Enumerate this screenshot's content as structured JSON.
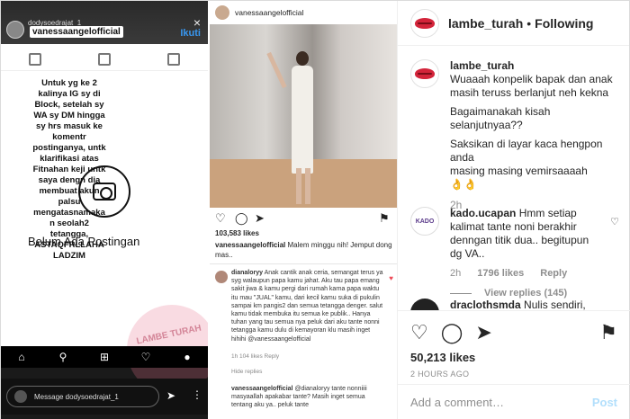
{
  "collage": {
    "story": {
      "story_user": "dodysoedrajat_1",
      "close": "×",
      "handle": "vanessaangelofficial",
      "follow_label": "Ikuti",
      "note": "Untuk yg ke 2\nkalinya IG sy di\nBlock, setelah sy\nWA sy DM hingga\nsy hrs masuk ke\nkomentr\npostinganya, untk\nklarifikasi atas\nFitnahan keji untk\nsaya dengn dia\nmembuat akun\npalsu\nmengatasnamaka\nn seolah2\ntetangga,\nASTAQFRLLAHA\nLADZIM",
      "empty_label": "Belum Ada Postingan",
      "watermark": "LAMBE TURAH",
      "message_placeholder": "Message dodysoedrajat_1"
    },
    "post": {
      "user": "vanessaangelofficial",
      "likes": "103,583 likes",
      "caption_user": "vanessaangelofficial",
      "caption_text": "Malem minggu nih! Jemput dong mas..",
      "comment1_user": "dianaloryy",
      "comment1_text": "Anak cantik anak ceria, semangat terus ya syg walaupun papa kamu jahat. Aku tau papa emang sakit jiwa & kamu pergi dari rumah karna papa waktu itu mau \"JUAL\" kamu, dari kecil kamu suka di pukulin sampai km pangis2 dan semua tetangga denger. salut kamu tidak membuka itu semua ke publik.. Hanya tuhan yang tau semua nya peluk dari aku tante nonni tetangga kamu dulu di kemayoran klu masih inget hihihi @vanessaangelofficial",
      "comment1_meta": "1h   104 likes   Reply",
      "hide_replies": "Hide replies",
      "comment2_user": "vanessaangelofficial",
      "comment2_text": "@dianaloryy tante nonniiii masyaallah apakabar tante? Masih inget semua tentang aku ya.. peluk tante"
    }
  },
  "header": {
    "username": "lambe_turah",
    "separator": "•",
    "follow_status": "Following"
  },
  "comments": [
    {
      "username": "lambe_turah",
      "lines": [
        "Wuaaah konpelik bapak dan anak",
        "masih teruss berlanjut neh kekna",
        "",
        "Bagaimanakah kisah selanjutnyaa??",
        "",
        "Saksikan di layar kaca hengpon anda",
        "masing masing vemirsaaaah",
        "👌👌"
      ],
      "time": "2h"
    },
    {
      "username": "kado.ucapan",
      "text": "Hmm setiap kalimat tante noni berakhir denngan titik dua.. begitupun dg VA..",
      "time": "2h",
      "likes": "1796 likes",
      "reply": "Reply",
      "view_replies": "View replies (145)",
      "avatar_label": "KADO"
    },
    {
      "username": "draclothsmda",
      "text": "Nulis sendiri,"
    }
  ],
  "actions": {
    "likes": "50,213 likes",
    "ago": "2 HOURS AGO"
  },
  "add_comment": {
    "placeholder": "Add a comment…",
    "post_label": "Post"
  }
}
